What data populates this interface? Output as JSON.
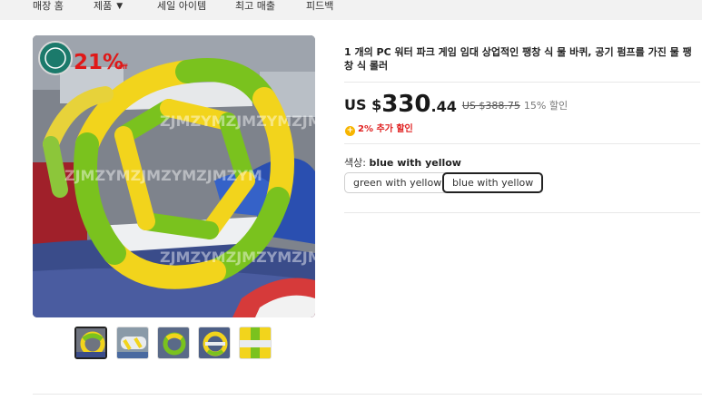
{
  "nav": {
    "items": [
      "매장 홈",
      "제품",
      "세일 아이템",
      "최고 매출",
      "피드백"
    ],
    "dropdown_icon": "chevron-down-icon"
  },
  "gallery": {
    "badge_text": "21%",
    "badge_sub": "off",
    "watermark": "ZJMZYMZJMZYMZJMZYM",
    "thumbnail_count": 5,
    "active_thumbnail": 1
  },
  "product": {
    "title": "1 개의 PC 워터 파크 게임 임대 상업적인 팽창 식 물 바퀴, 공기 펌프를 가진 물 팽창 식 롤러",
    "price": {
      "currency": "US $",
      "integer": "330",
      "decimal": ".44",
      "original": "US $388.75",
      "discount": "15% 할인"
    },
    "extra_discount": "2% 추가 할인",
    "extra_icon": "coin-icon",
    "color": {
      "label": "색상:",
      "selected": "blue with yellow",
      "options": [
        "green with yellow",
        "blue with yellow"
      ]
    }
  },
  "colors": {
    "accent_red": "#e02020",
    "coin_yellow": "#f7b500",
    "wheel_yellow": "#f2d41c",
    "wheel_green": "#7ac21e"
  }
}
